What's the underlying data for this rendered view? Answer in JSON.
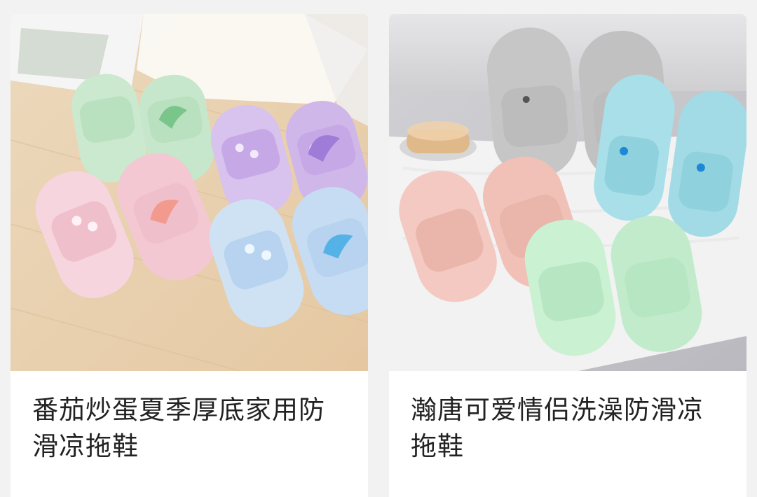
{
  "products": [
    {
      "title": "番茄炒蛋夏季厚底家用防滑凉拖鞋",
      "image_icon": "slippers-photo-icon",
      "image_colors": [
        "#cbe9cf",
        "#d8c2ee",
        "#f6d5de",
        "#cfe2f4"
      ],
      "background_color": "#e9d4b8"
    },
    {
      "title": "瀚唐可爱情侣洗澡防滑凉拖鞋",
      "image_icon": "slippers-photo-icon",
      "image_colors": [
        "#c6c6c6",
        "#a9dfe8",
        "#f4c9c1",
        "#c9f1d2"
      ],
      "background_color": "#c9c9cc"
    }
  ]
}
